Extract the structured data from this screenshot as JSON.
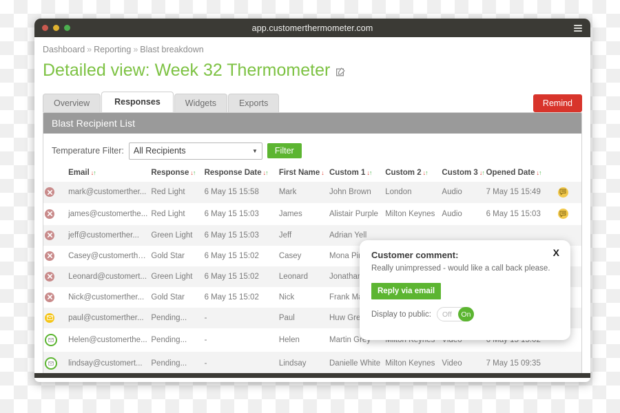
{
  "browser": {
    "url": "app.customerthermometer.com",
    "menu_icon": "hamburger-icon"
  },
  "breadcrumb": {
    "items": [
      "Dashboard",
      "Reporting",
      "Blast breakdown"
    ],
    "separator": "»"
  },
  "page": {
    "title": "Detailed view: Week 32 Thermometer",
    "edit_icon": "edit-square-icon"
  },
  "tabs": [
    {
      "label": "Overview",
      "active": false
    },
    {
      "label": "Responses",
      "active": true
    },
    {
      "label": "Widgets",
      "active": false
    },
    {
      "label": "Exports",
      "active": false
    }
  ],
  "actions": {
    "remind_label": "Remind"
  },
  "panel": {
    "header": "Blast Recipient List",
    "filter_label": "Temperature Filter:",
    "filter_value": "All Recipients",
    "filter_button": "Filter"
  },
  "table": {
    "columns": [
      {
        "key": "status",
        "label": ""
      },
      {
        "key": "email",
        "label": "Email",
        "sortable": true
      },
      {
        "key": "response",
        "label": "Response",
        "sortable": true
      },
      {
        "key": "response_date",
        "label": "Response Date",
        "sortable": true
      },
      {
        "key": "first_name",
        "label": "First Name",
        "sortable": true
      },
      {
        "key": "custom1",
        "label": "Custom 1",
        "sortable": true
      },
      {
        "key": "custom2",
        "label": "Custom 2",
        "sortable": true
      },
      {
        "key": "custom3",
        "label": "Custom 3",
        "sortable": true
      },
      {
        "key": "opened_date",
        "label": "Opened Date",
        "sortable": true
      },
      {
        "key": "comment",
        "label": ""
      }
    ],
    "rows": [
      {
        "status": "bounced-icon",
        "email": "mark@customerther...",
        "response": "Red Light",
        "response_date": "6 May 15 15:58",
        "first_name": "Mark",
        "custom1": "John Brown",
        "custom2": "London",
        "custom3": "Audio",
        "opened_date": "7 May 15 15:49",
        "comment": "comment-bubble-icon"
      },
      {
        "status": "bounced-icon",
        "email": "james@customerthe...",
        "response": "Red Light",
        "response_date": "6 May 15 15:03",
        "first_name": "James",
        "custom1": "Alistair Purple",
        "custom2": "Milton Keynes",
        "custom3": "Audio",
        "opened_date": "6 May 15 15:03",
        "comment": "comment-bubble-icon"
      },
      {
        "status": "bounced-icon",
        "email": "jeff@customerther...",
        "response": "Green Light",
        "response_date": "6 May 15 15:03",
        "first_name": "Jeff",
        "custom1": "Adrian Yell",
        "custom2": "",
        "custom3": "",
        "opened_date": "",
        "comment": ""
      },
      {
        "status": "bounced-icon",
        "email": "Casey@customerthe...",
        "response": "Gold Star",
        "response_date": "6 May 15 15:02",
        "first_name": "Casey",
        "custom1": "Mona Pink",
        "custom2": "",
        "custom3": "",
        "opened_date": "",
        "comment": ""
      },
      {
        "status": "bounced-icon",
        "email": "Leonard@customert...",
        "response": "Green Light",
        "response_date": "6 May 15 15:02",
        "first_name": "Leonard",
        "custom1": "Jonathan B",
        "custom2": "",
        "custom3": "",
        "opened_date": "",
        "comment": ""
      },
      {
        "status": "bounced-icon",
        "email": "Nick@customerther...",
        "response": "Gold Star",
        "response_date": "6 May 15 15:02",
        "first_name": "Nick",
        "custom1": "Frank Mau",
        "custom2": "",
        "custom3": "",
        "opened_date": "",
        "comment": ""
      },
      {
        "status": "pending-yellow-icon",
        "email": "paul@customerther...",
        "response": "Pending...",
        "response_date": "-",
        "first_name": "Paul",
        "custom1": "Huw Green",
        "custom2": "",
        "custom3": "",
        "opened_date": "",
        "comment": ""
      },
      {
        "status": "pending-green-icon",
        "email": "Helen@customerthe...",
        "response": "Pending...",
        "response_date": "-",
        "first_name": "Helen",
        "custom1": "Martin Grey",
        "custom2": "Milton Keynes",
        "custom3": "Video",
        "opened_date": "6 May 15 15:02",
        "comment": ""
      },
      {
        "status": "pending-green-icon",
        "email": "lindsay@customert...",
        "response": "Pending...",
        "response_date": "-",
        "first_name": "Lindsay",
        "custom1": "Danielle White",
        "custom2": "Milton Keynes",
        "custom3": "Video",
        "opened_date": "7 May 15 09:35",
        "comment": ""
      }
    ]
  },
  "comment_popup": {
    "title": "Customer comment:",
    "text": "Really unimpressed - would like a call back please.",
    "reply_label": "Reply via email",
    "display_label": "Display to public:",
    "toggle_off": "Off",
    "toggle_on": "On",
    "close_label": "X"
  },
  "colors": {
    "brand_green": "#7dc243",
    "button_green": "#5cb531",
    "remind_red": "#d8342b",
    "panel_grey": "#9a9a9a",
    "titlebar": "#3b3a35",
    "sort_down": "#e03a2f",
    "sort_up": "#49b749",
    "bubble_yellow": "#f2c94c"
  }
}
